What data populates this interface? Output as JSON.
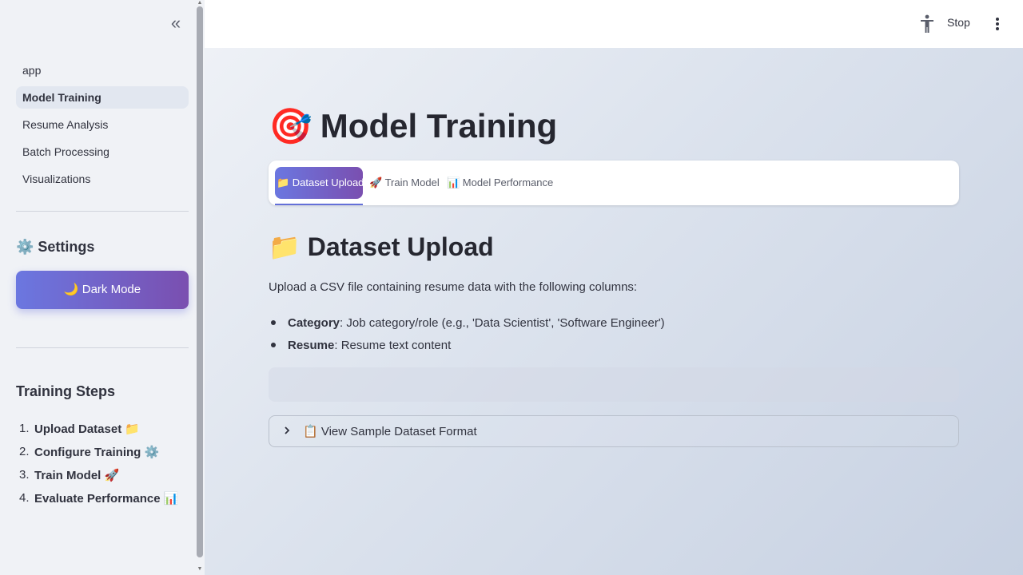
{
  "sidebar": {
    "collapse_label": "«",
    "nav": [
      {
        "label": "app"
      },
      {
        "label": "Model Training"
      },
      {
        "label": "Resume Analysis"
      },
      {
        "label": "Batch Processing"
      },
      {
        "label": "Visualizations"
      }
    ],
    "active_nav": "Model Training",
    "settings_title": "⚙️ Settings",
    "dark_mode_label": "🌙 Dark Mode",
    "steps_title": "Training Steps",
    "steps": [
      {
        "num": "1.",
        "label": "Upload Dataset 📁"
      },
      {
        "num": "2.",
        "label": "Configure Training ⚙️"
      },
      {
        "num": "3.",
        "label": "Train Model 🚀"
      },
      {
        "num": "4.",
        "label": "Evaluate Performance 📊"
      }
    ]
  },
  "header": {
    "stop_label": "Stop",
    "running_icon": "running-person-icon",
    "menu_icon": "kebab-menu-icon"
  },
  "main": {
    "title_emoji": "🎯",
    "title": "Model Training",
    "tabs": [
      {
        "label": "📁 Dataset Upload"
      },
      {
        "label": "🚀 Train Model"
      },
      {
        "label": "📊 Model Performance"
      }
    ],
    "active_tab": "📁 Dataset Upload",
    "section_title": "📁 Dataset Upload",
    "description": "Upload a CSV file containing resume data with the following columns:",
    "bullets": [
      {
        "term": "Category",
        "text": ": Job category/role (e.g., 'Data Scientist', 'Software Engineer')"
      },
      {
        "term": "Resume",
        "text": ": Resume text content"
      }
    ],
    "expander_label": "📋 View Sample Dataset Format"
  },
  "colors": {
    "accent_start": "#6b77e0",
    "accent_end": "#7a4fb0",
    "sidebar_bg": "#f0f2f6"
  }
}
